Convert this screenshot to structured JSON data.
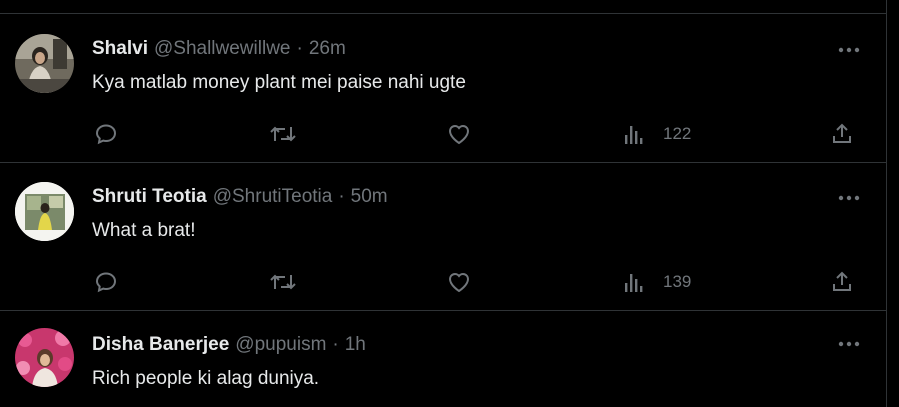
{
  "colors": {
    "background": "#000000",
    "text_primary": "#e7e9ea",
    "text_secondary": "#71767b",
    "divider": "#2f3336"
  },
  "tweets": [
    {
      "author_name": "Shalvi",
      "handle": "@Shallwewillwe",
      "separator": "·",
      "time": "26m",
      "text": "Kya matlab money plant mei paise nahi ugte",
      "views": "122",
      "icons": [
        "reply-icon",
        "retweet-icon",
        "like-icon",
        "views-icon",
        "share-icon",
        "more-icon"
      ]
    },
    {
      "author_name": "Shruti Teotia",
      "handle": "@ShrutiTeotia",
      "separator": "·",
      "time": "50m",
      "text": "What a brat!",
      "views": "139",
      "icons": [
        "reply-icon",
        "retweet-icon",
        "like-icon",
        "views-icon",
        "share-icon",
        "more-icon"
      ]
    },
    {
      "author_name": "Disha Banerjee",
      "handle": "@pupuism",
      "separator": "·",
      "time": "1h",
      "text": "Rich people ki alag duniya.",
      "icons": [
        "more-icon"
      ]
    }
  ]
}
